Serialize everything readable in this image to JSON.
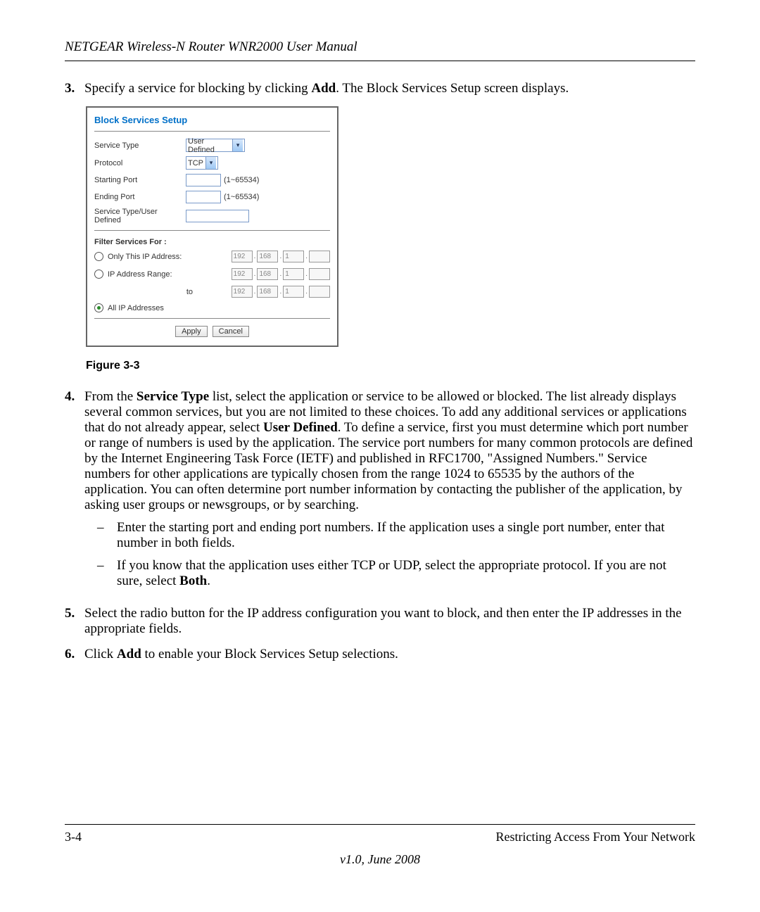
{
  "header": "NETGEAR Wireless-N Router WNR2000 User Manual",
  "steps": {
    "s3": {
      "num": "3.",
      "pre": "Specify a service for blocking by clicking ",
      "bold": "Add",
      "post": ". The Block Services Setup screen displays."
    },
    "s4": {
      "num": "4.",
      "p1a": "From the ",
      "p1bold1": "Service Type",
      "p1b": " list, select the application or service to be allowed or blocked. The list already displays several common services, but you are not limited to these choices. To add any additional services or applications that do not already appear, select ",
      "p1bold2": "User Defined",
      "p1c": ". To define a service, first you must determine which port number or range of numbers is used by the application. The service port numbers for many common protocols are defined by the Internet Engineering Task Force (IETF) and published in RFC1700, \"Assigned Numbers.\" Service numbers for other applications are typically chosen from the range 1024 to 65535 by the authors of the application. You can often determine port number information by contacting the publisher of the application, by asking user groups or newsgroups, or by searching.",
      "sub1": "Enter the starting port and ending port numbers. If the application uses a single port number, enter that number in both fields.",
      "sub2a": "If you know that the application uses either TCP or UDP, select the appropriate protocol. If you are not sure, select ",
      "sub2bold": "Both",
      "sub2b": "."
    },
    "s5": {
      "num": "5.",
      "text": "Select the radio button for the IP address configuration you want to block, and then enter the IP addresses in the appropriate fields."
    },
    "s6": {
      "num": "6.",
      "pre": "Click ",
      "bold": "Add",
      "post": " to enable your Block Services Setup selections."
    }
  },
  "figure_caption": "Figure 3-3",
  "shot": {
    "title": "Block Services Setup",
    "service_type_label": "Service Type",
    "service_type_value": "User Defined",
    "protocol_label": "Protocol",
    "protocol_value": "TCP",
    "start_port_label": "Starting Port",
    "end_port_label": "Ending Port",
    "port_range": "(1~65534)",
    "user_defined_label": "Service Type/User Defined",
    "filter_label": "Filter Services For :",
    "only_ip_label": "Only This IP Address:",
    "range_label": "IP Address Range:",
    "to_label": "to",
    "all_ip_label": "All IP Addresses",
    "oct1": "192",
    "oct2": "168",
    "oct3": "1",
    "apply": "Apply",
    "cancel": "Cancel"
  },
  "footer": {
    "page": "3-4",
    "section": "Restricting Access From Your Network",
    "version": "v1.0, June 2008"
  }
}
